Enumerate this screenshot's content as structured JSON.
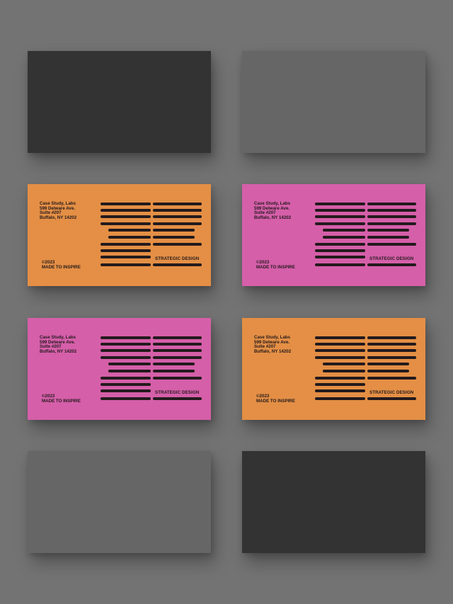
{
  "colors": {
    "background": "#737373",
    "dark": "#333333",
    "grey": "#666666",
    "orange": "#e48f45",
    "pink": "#d55fa9",
    "ink": "#231a1d"
  },
  "cards": [
    {
      "slot": "r1 c-left",
      "kind": "blank",
      "color": "#333333"
    },
    {
      "slot": "r1 c-right",
      "kind": "blank",
      "color": "#666666"
    },
    {
      "slot": "r2 c-left",
      "kind": "business",
      "color": "#e48f45"
    },
    {
      "slot": "r2 c-right",
      "kind": "business",
      "color": "#d55fa9"
    },
    {
      "slot": "r3 c-left",
      "kind": "business",
      "color": "#d55fa9"
    },
    {
      "slot": "r3 c-right",
      "kind": "business",
      "color": "#e48f45"
    },
    {
      "slot": "r4 c-left",
      "kind": "blank",
      "color": "#666666"
    },
    {
      "slot": "r4 c-right",
      "kind": "blank",
      "color": "#333333"
    }
  ],
  "card_text": {
    "address": [
      "Case Study, Labs",
      "599 Delware Ave.",
      "Suite #207",
      "Buffalo, NY 14202"
    ],
    "copyright": "©2023",
    "motto": "MADE TO INSPIRE",
    "tagline": "STRATEGIC DESIGN"
  }
}
